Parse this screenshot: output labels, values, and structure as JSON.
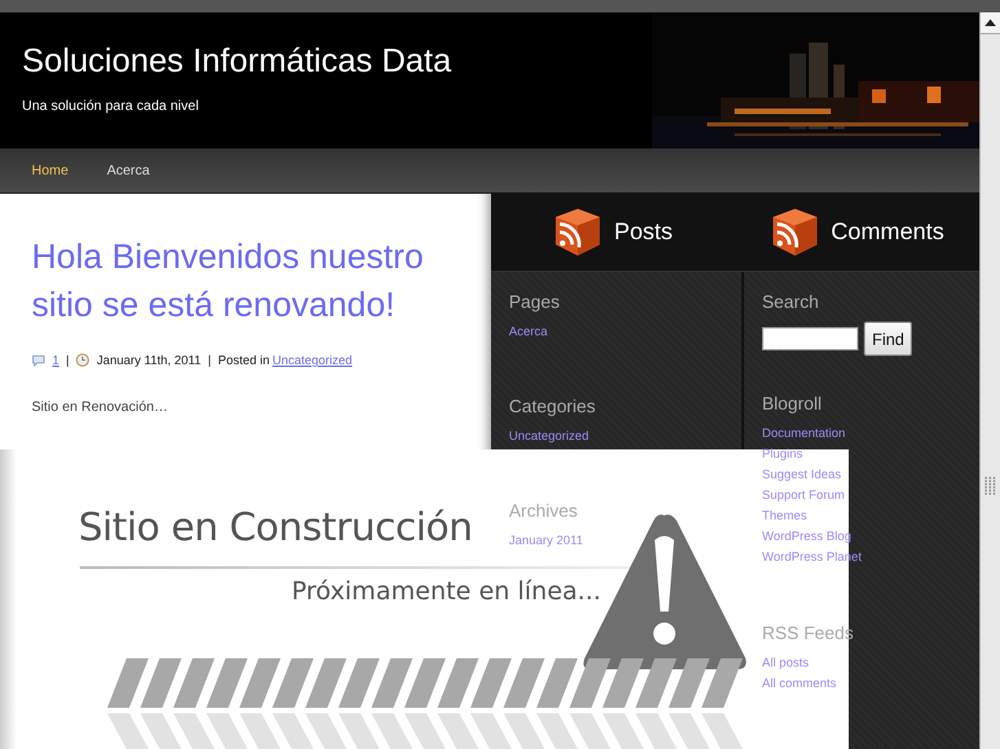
{
  "site": {
    "title": "Soluciones Informáticas Data",
    "tagline": "Una solución para cada nivel"
  },
  "nav": [
    {
      "label": "Home",
      "selected": true
    },
    {
      "label": "Acerca",
      "selected": false
    }
  ],
  "post": {
    "title": "Hola Bienvenidos nuestro sitio se está renovando!",
    "comments": "1",
    "date": "January 11th, 2011",
    "category_prefix": "Posted in",
    "category": "Uncategorized",
    "separators": [
      "|",
      "|"
    ],
    "excerpt": "Sitio en Renovación…"
  },
  "feeds": [
    {
      "label": "Posts"
    },
    {
      "label": "Comments"
    }
  ],
  "sidebar_left": [
    {
      "heading": "Pages",
      "links": [
        "Acerca"
      ]
    },
    {
      "heading": "Categories",
      "links": [
        "Uncategorized"
      ]
    },
    {
      "heading": "Archives",
      "links": [
        "January 2011"
      ]
    }
  ],
  "search": {
    "heading": "Search",
    "button": "Find"
  },
  "sidebar_right": [
    {
      "heading": "Blogroll",
      "links": [
        "Documentation",
        "Plugins",
        "Suggest Ideas",
        "Support Forum",
        "Themes",
        "WordPress Blog",
        "WordPress Planet"
      ]
    },
    {
      "heading": "RSS Feeds",
      "links": [
        "All posts",
        "All comments"
      ]
    }
  ],
  "banner": {
    "title": "Sitio en Construcción",
    "subtitle": "Próximamente en línea..."
  }
}
